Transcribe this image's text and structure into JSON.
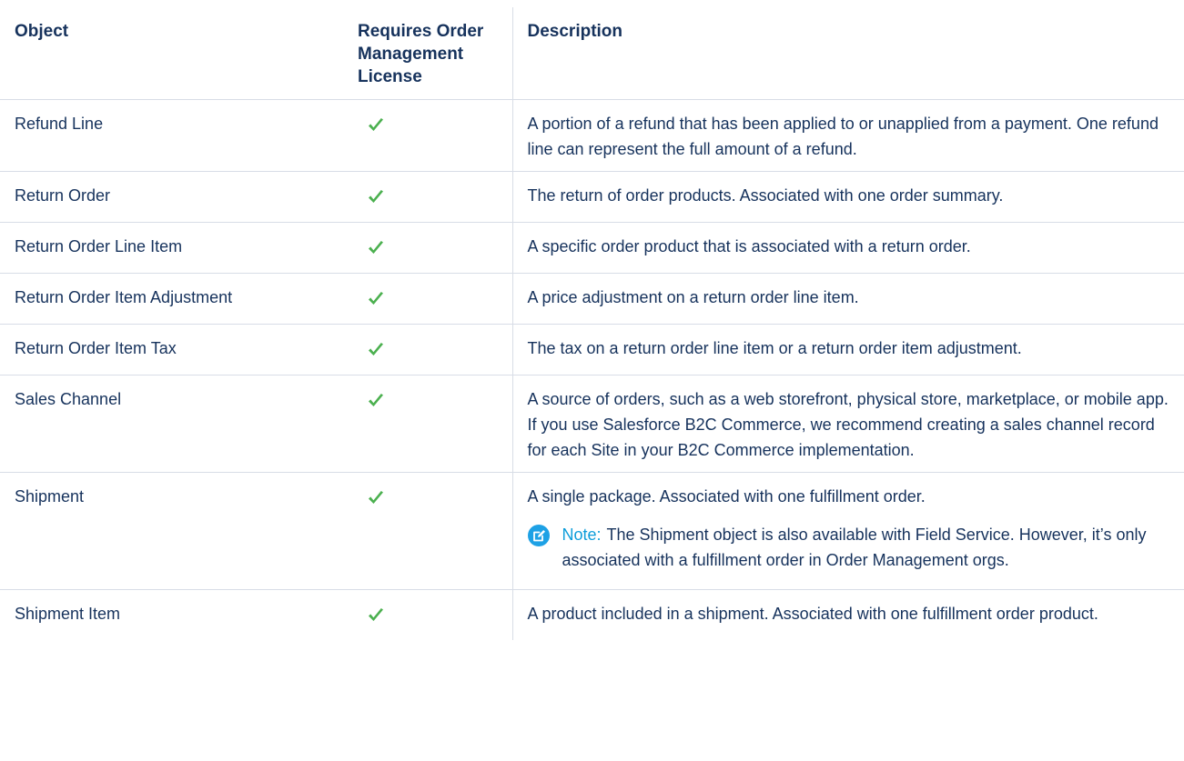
{
  "table": {
    "headers": {
      "object": "Object",
      "license": "Requires Order Management License",
      "description": "Description"
    },
    "rows": [
      {
        "object": "Refund Line",
        "requires_license": true,
        "description": "A portion of a refund that has been applied to or unapplied from a payment. One refund line can represent the full amount of a refund."
      },
      {
        "object": "Return Order",
        "requires_license": true,
        "description": "The return of order products. Associated with one order summary."
      },
      {
        "object": "Return Order Line Item",
        "requires_license": true,
        "description": "A specific order product that is associated with a return order."
      },
      {
        "object": "Return Order Item Adjustment",
        "requires_license": true,
        "description": "A price adjustment on a return order line item."
      },
      {
        "object": "Return Order Item Tax",
        "requires_license": true,
        "description": "The tax on a return order line item or a return order item adjustment."
      },
      {
        "object": "Sales Channel",
        "requires_license": true,
        "description": "A source of orders, such as a web storefront, physical store, marketplace, or mobile app. If you use Salesforce B2C Commerce, we recommend creating a sales channel record for each Site in your B2C Commerce implementation."
      },
      {
        "object": "Shipment",
        "requires_license": true,
        "description": "A single package. Associated with one fulfillment order.",
        "note": {
          "label": "Note:",
          "text": "The Shipment object is also available with Field Service. However, it’s only associated with a fulfillment order in Order Management orgs."
        }
      },
      {
        "object": "Shipment Item",
        "requires_license": true,
        "description": "A product included in a shipment. Associated with one fulfillment order product."
      }
    ]
  },
  "colors": {
    "text": "#16325c",
    "check": "#4bb04f",
    "note_accent": "#0d9dda",
    "border": "#d8dde6"
  },
  "icons": {
    "check": "check-icon",
    "note": "edit-note-icon"
  }
}
